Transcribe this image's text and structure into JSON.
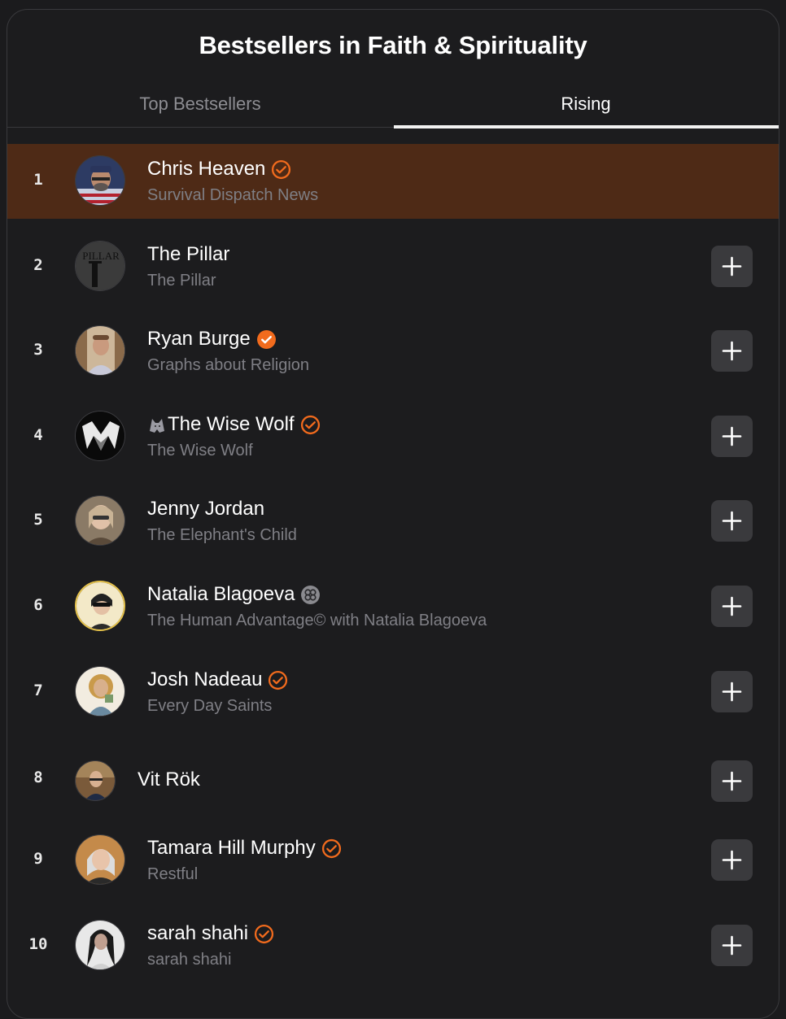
{
  "header": {
    "title": "Bestsellers in Faith & Spirituality"
  },
  "tabs": [
    {
      "label": "Top Bestsellers",
      "active": false
    },
    {
      "label": "Rising",
      "active": true
    }
  ],
  "colors": {
    "accent": "#f26b1d",
    "highlight_row": "#4e2a16",
    "background": "#1c1c1e",
    "button": "#3a3a3d",
    "subtitle": "#7f7f85"
  },
  "rows": [
    {
      "rank": "1",
      "name": "Chris Heaven",
      "publication": "Survival Dispatch News",
      "badge": "verified-outline-icon",
      "highlighted": true,
      "has_add": false
    },
    {
      "rank": "2",
      "name": "The Pillar",
      "publication": "The Pillar",
      "badge": "",
      "highlighted": false,
      "has_add": true
    },
    {
      "rank": "3",
      "name": "Ryan Burge",
      "publication": "Graphs about Religion",
      "badge": "verified-filled-icon",
      "highlighted": false,
      "has_add": true
    },
    {
      "rank": "4",
      "name": "The Wise Wolf",
      "publication": "The Wise Wolf",
      "badge": "verified-outline-icon",
      "highlighted": false,
      "has_add": true
    },
    {
      "rank": "5",
      "name": "Jenny Jordan",
      "publication": "The Elephant's Child",
      "badge": "",
      "highlighted": false,
      "has_add": true
    },
    {
      "rank": "6",
      "name": "Natalia Blagoeva",
      "publication": "The Human Advantage© with Natalia Blagoeva",
      "badge": "clover-badge-icon",
      "highlighted": false,
      "has_add": true
    },
    {
      "rank": "7",
      "name": "Josh Nadeau",
      "publication": "Every Day Saints",
      "badge": "verified-outline-icon",
      "highlighted": false,
      "has_add": true
    },
    {
      "rank": "8",
      "name": "Vit Rök",
      "publication": "",
      "badge": "",
      "highlighted": false,
      "has_add": true
    },
    {
      "rank": "9",
      "name": "Tamara Hill Murphy",
      "publication": "Restful",
      "badge": "verified-outline-icon",
      "highlighted": false,
      "has_add": true
    },
    {
      "rank": "10",
      "name": "sarah shahi",
      "publication": "sarah shahi",
      "badge": "verified-outline-icon",
      "highlighted": false,
      "has_add": true
    }
  ]
}
